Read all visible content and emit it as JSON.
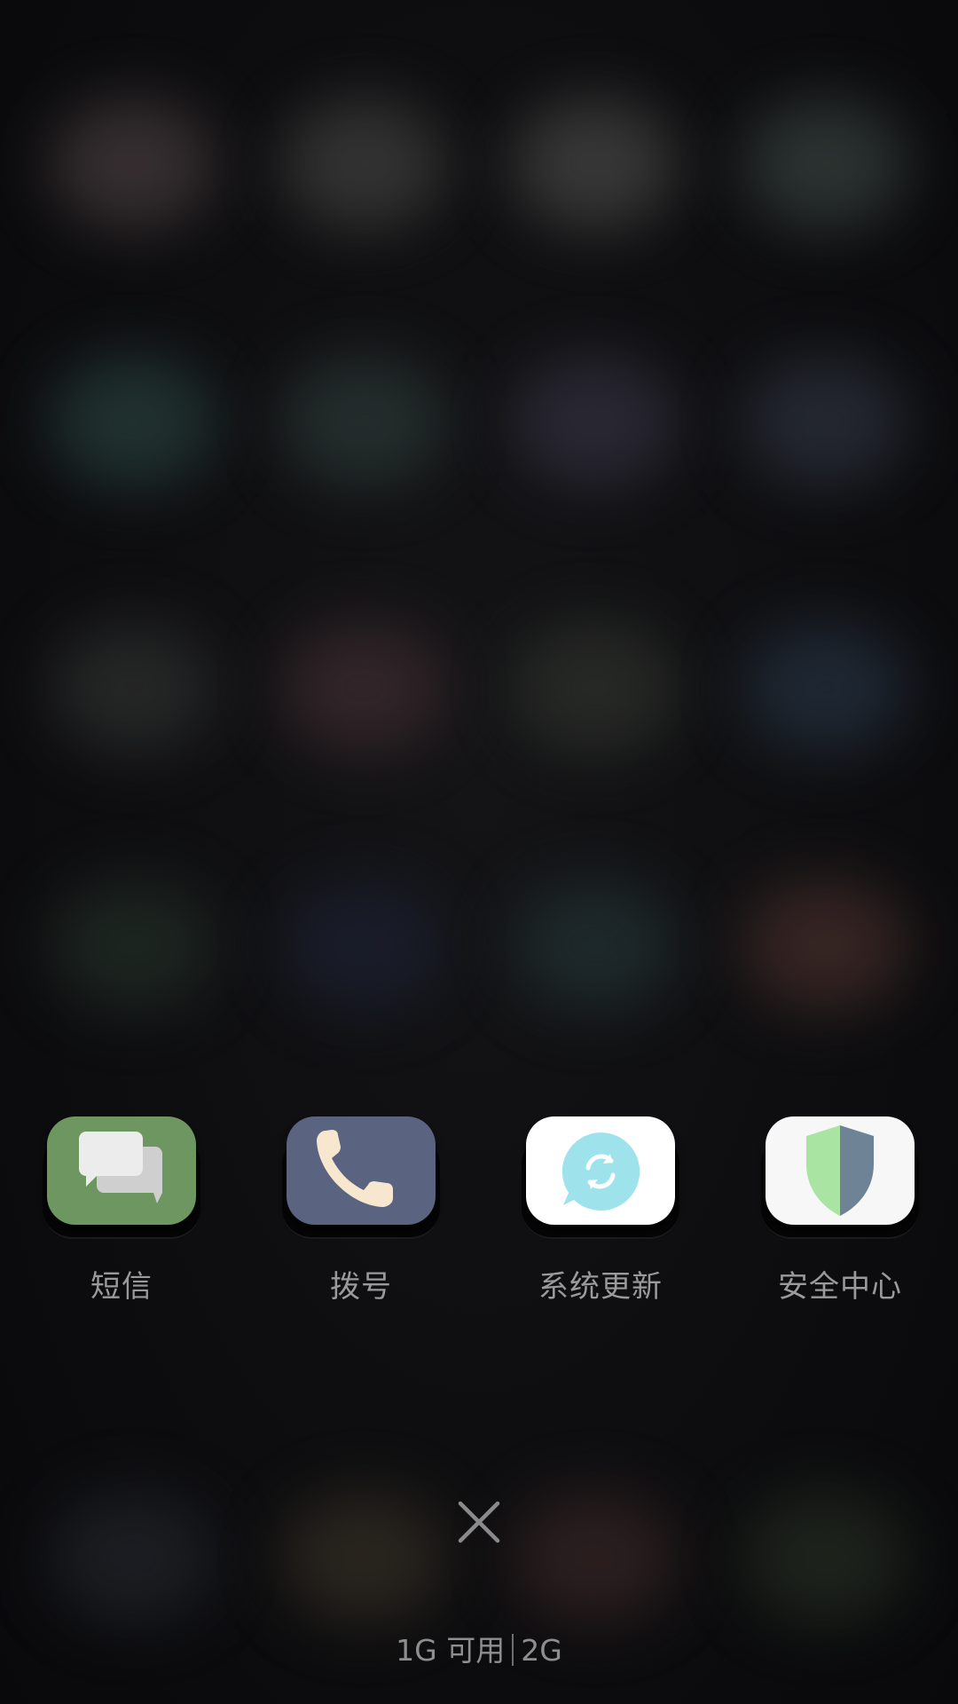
{
  "recent_apps": [
    {
      "label": "短信",
      "icon": "messages-icon",
      "tile_color": "#6e9660"
    },
    {
      "label": "拨号",
      "icon": "phone-icon",
      "tile_color": "#5a6380"
    },
    {
      "label": "系统更新",
      "icon": "system-update-icon",
      "tile_color": "#ffffff"
    },
    {
      "label": "安全中心",
      "icon": "security-shield-icon",
      "tile_color": "#ffffff"
    }
  ],
  "close_all": {
    "icon": "close-icon"
  },
  "memory": {
    "available": "1G 可用",
    "total": "2G"
  },
  "colors": {
    "background": "#0e0e10",
    "label_text": "#9a9a9c",
    "update_bubble": "#9ee3ec",
    "shield_left": "#a9e4a3",
    "shield_right": "#6f8396"
  }
}
